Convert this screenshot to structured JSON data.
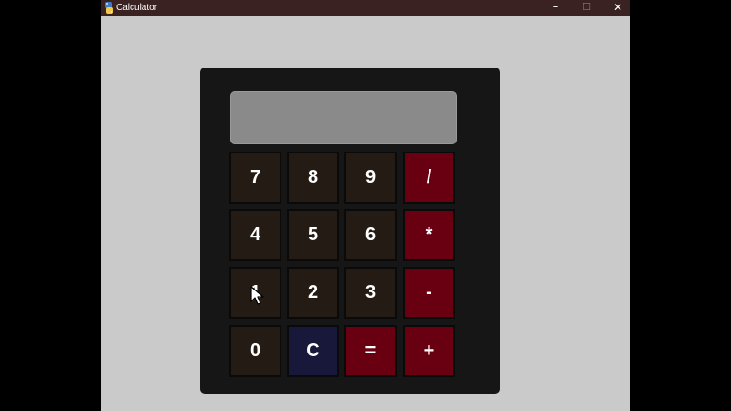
{
  "window": {
    "title": "Calculator",
    "app_icon": "python-icon",
    "controls": {
      "minimize": "minimize-icon",
      "maximize": "maximize-icon",
      "close": "close-icon"
    }
  },
  "calculator": {
    "display_value": "",
    "keys": [
      {
        "label": "7",
        "kind": "digit"
      },
      {
        "label": "8",
        "kind": "digit"
      },
      {
        "label": "9",
        "kind": "digit"
      },
      {
        "label": "/",
        "kind": "operator"
      },
      {
        "label": "4",
        "kind": "digit"
      },
      {
        "label": "5",
        "kind": "digit"
      },
      {
        "label": "6",
        "kind": "digit"
      },
      {
        "label": "*",
        "kind": "operator"
      },
      {
        "label": "1",
        "kind": "digit"
      },
      {
        "label": "2",
        "kind": "digit"
      },
      {
        "label": "3",
        "kind": "digit"
      },
      {
        "label": "-",
        "kind": "operator"
      },
      {
        "label": "0",
        "kind": "digit"
      },
      {
        "label": "C",
        "kind": "clear"
      },
      {
        "label": "=",
        "kind": "equals"
      },
      {
        "label": "+",
        "kind": "operator"
      }
    ]
  },
  "colors": {
    "titlebar": "#3a2222",
    "window_background": "#cacaca",
    "calculator_body": "#161616",
    "display": "#8a8a8a",
    "digit_key": "#241c14",
    "operator_key": "#680012",
    "clear_key": "#18193a"
  }
}
